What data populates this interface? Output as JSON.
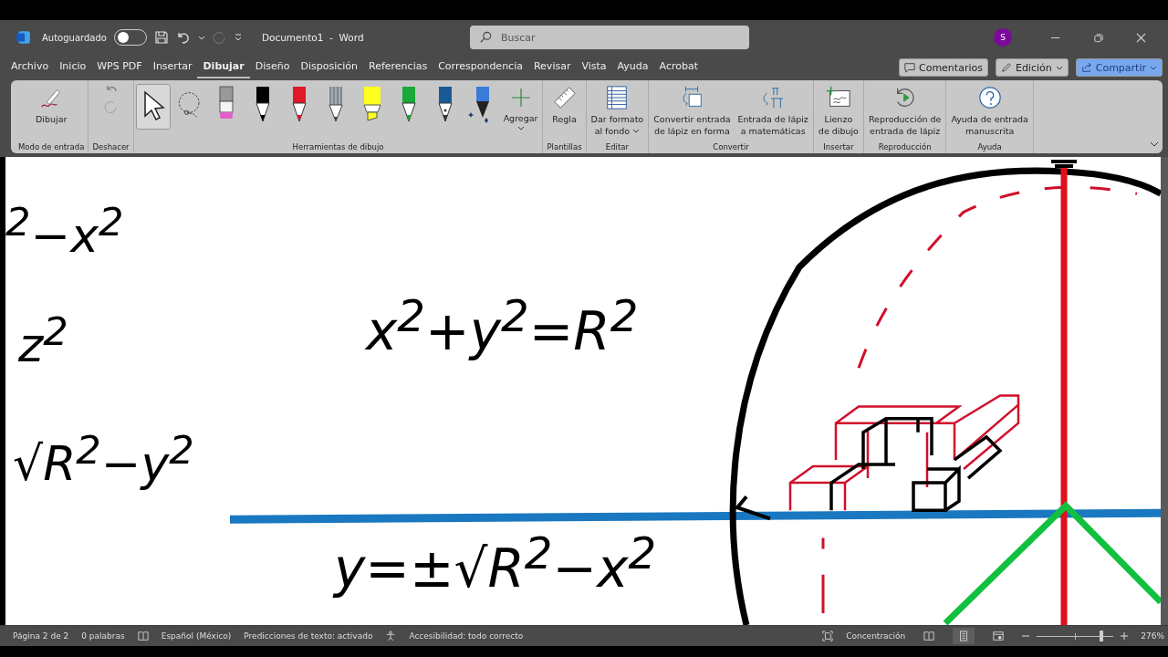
{
  "titlebar": {
    "autosave_label": "Autoguardado",
    "autosave_on": false,
    "redo_disabled": true,
    "document_title": "Documento1  -  Word",
    "search": {
      "placeholder": "Buscar"
    },
    "avatar": "S"
  },
  "menu_tabs": [
    {
      "label": "Archivo",
      "selected": false
    },
    {
      "label": "Inicio",
      "selected": false
    },
    {
      "label": "WPS PDF",
      "selected": false
    },
    {
      "label": "Insertar",
      "selected": false
    },
    {
      "label": "Dibujar",
      "selected": true
    },
    {
      "label": "Diseño",
      "selected": false
    },
    {
      "label": "Disposición",
      "selected": false
    },
    {
      "label": "Referencias",
      "selected": false
    },
    {
      "label": "Correspondencia",
      "selected": false
    },
    {
      "label": "Revisar",
      "selected": false
    },
    {
      "label": "Vista",
      "selected": false
    },
    {
      "label": "Ayuda",
      "selected": false
    },
    {
      "label": "Acrobat",
      "selected": false
    }
  ],
  "actions": [
    {
      "kind": "comments",
      "label": "Comentarios"
    },
    {
      "kind": "edit",
      "label": "Edición"
    },
    {
      "kind": "share",
      "label": "Compartir"
    }
  ],
  "ribbon": [
    {
      "label": "Modo de entrada",
      "items": [
        {
          "kind": "draw",
          "label": "Dibujar"
        }
      ]
    },
    {
      "label": "Deshacer",
      "items": [
        {
          "kind": "undo",
          "disabled": false
        },
        {
          "kind": "redo",
          "disabled": true
        }
      ]
    },
    {
      "label": "Herramientas de dibujo",
      "items": [
        {
          "kind": "select",
          "selected": true
        },
        {
          "kind": "lasso",
          "selected": false
        },
        {
          "kind": "eraser",
          "selected": false,
          "color": "#e060c8"
        },
        {
          "kind": "pen",
          "selected": false,
          "color": "#000000"
        },
        {
          "kind": "pen",
          "selected": false,
          "color": "#e01828"
        },
        {
          "kind": "pencil",
          "selected": false,
          "color": "#7a8a96"
        },
        {
          "kind": "highlighter",
          "selected": false,
          "color": "#ffff20"
        },
        {
          "kind": "pen",
          "selected": false,
          "color": "#1aa83a"
        },
        {
          "kind": "fountain",
          "selected": false,
          "color": "#1a5a96"
        },
        {
          "kind": "galaxy",
          "selected": false,
          "color": "#3a7ad8"
        },
        {
          "kind": "add",
          "label": "Agregar"
        }
      ]
    },
    {
      "label": "Plantillas",
      "items": [
        {
          "kind": "ruler",
          "label": "Regla"
        }
      ]
    },
    {
      "label": "Editar",
      "items": [
        {
          "kind": "background",
          "label": "Dar formato\nal fondo",
          "dropdown": true
        }
      ]
    },
    {
      "label": "Convertir",
      "items": [
        {
          "kind": "ink-shape",
          "label": "Convertir entrada\nde lápiz en forma"
        },
        {
          "kind": "ink-math",
          "label": "Entrada de lápiz\na matemáticas"
        }
      ]
    },
    {
      "label": "Insertar",
      "items": [
        {
          "kind": "canvas",
          "label": "Lienzo\nde dibujo"
        }
      ]
    },
    {
      "label": "Reproducción",
      "items": [
        {
          "kind": "replay",
          "label": "Reproducción de\nentrada de lápiz"
        }
      ]
    },
    {
      "label": "Ayuda",
      "items": [
        {
          "kind": "help",
          "label": "Ayuda de entrada\nmanuscrita"
        }
      ]
    }
  ],
  "equations": [
    "$^{2}$−x$^{2}$",
    "z$^{2}$",
    "√R$^{2}$−y$^{2}$",
    "x$^{2}$+y$^{2}$=R$^{2}$",
    "y=±√R$^{2}$−x$^{2}$"
  ],
  "status_bar": {
    "page": "Página 2 de 2",
    "words": "0 palabras",
    "language": "Español (México)",
    "predictions": "Predicciones de texto: activado",
    "accessibility": "Accesibilidad: todo correcto",
    "focus": "Concentración",
    "views": [
      {
        "kind": "read",
        "selected": false
      },
      {
        "kind": "print",
        "selected": true
      },
      {
        "kind": "web",
        "selected": false
      }
    ],
    "zoom": {
      "level": 0.84,
      "reading": "276%"
    }
  }
}
